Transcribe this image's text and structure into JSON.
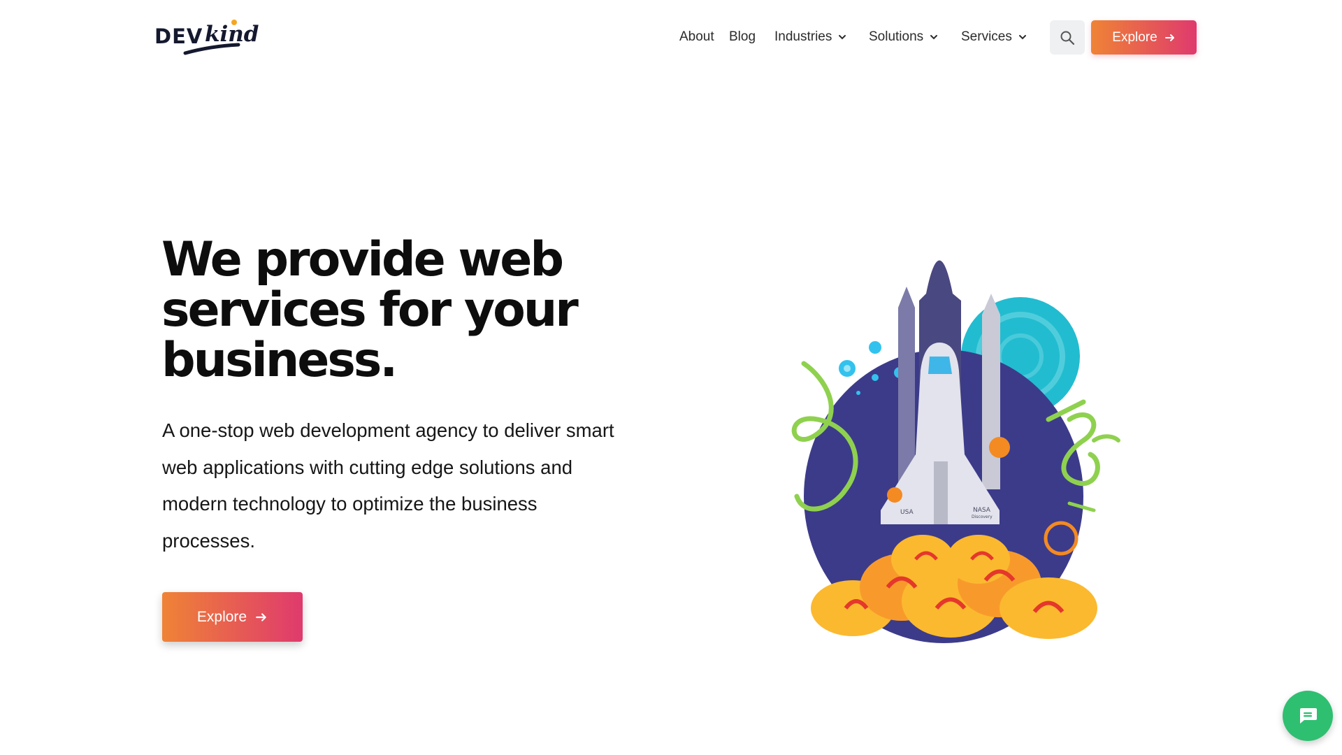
{
  "brand": {
    "name_part1": "DEV",
    "name_part2": "kind",
    "colors": {
      "dark": "#15192f",
      "accent_dot": "#f4a623"
    }
  },
  "nav": {
    "items": [
      {
        "label": "About",
        "has_dropdown": false
      },
      {
        "label": "Blog",
        "has_dropdown": false
      },
      {
        "label": "Industries",
        "has_dropdown": true
      },
      {
        "label": "Solutions",
        "has_dropdown": true
      },
      {
        "label": "Services",
        "has_dropdown": true
      }
    ],
    "search_icon": "search-icon",
    "cta_label": "Explore",
    "cta_icon": "arrow-right-icon"
  },
  "hero": {
    "title_lines": [
      "We provide web",
      "services for your",
      "business."
    ],
    "description": "A one-stop web development agency to deliver smart web applications with cutting edge solutions and modern technology to optimize the business processes.",
    "cta_label": "Explore",
    "cta_icon": "arrow-right-icon",
    "illustration": {
      "icon": "space-shuttle-launch-illustration",
      "orbiter_label_left": "USA",
      "orbiter_label_right_1": "NASA",
      "orbiter_label_right_2": "Discovery"
    }
  },
  "chat": {
    "icon": "chat-icon"
  },
  "colors": {
    "gradient_start": "#ef8336",
    "gradient_end": "#df3a6d",
    "chat_green": "#2fbf71",
    "search_bg": "#eef0f2"
  }
}
